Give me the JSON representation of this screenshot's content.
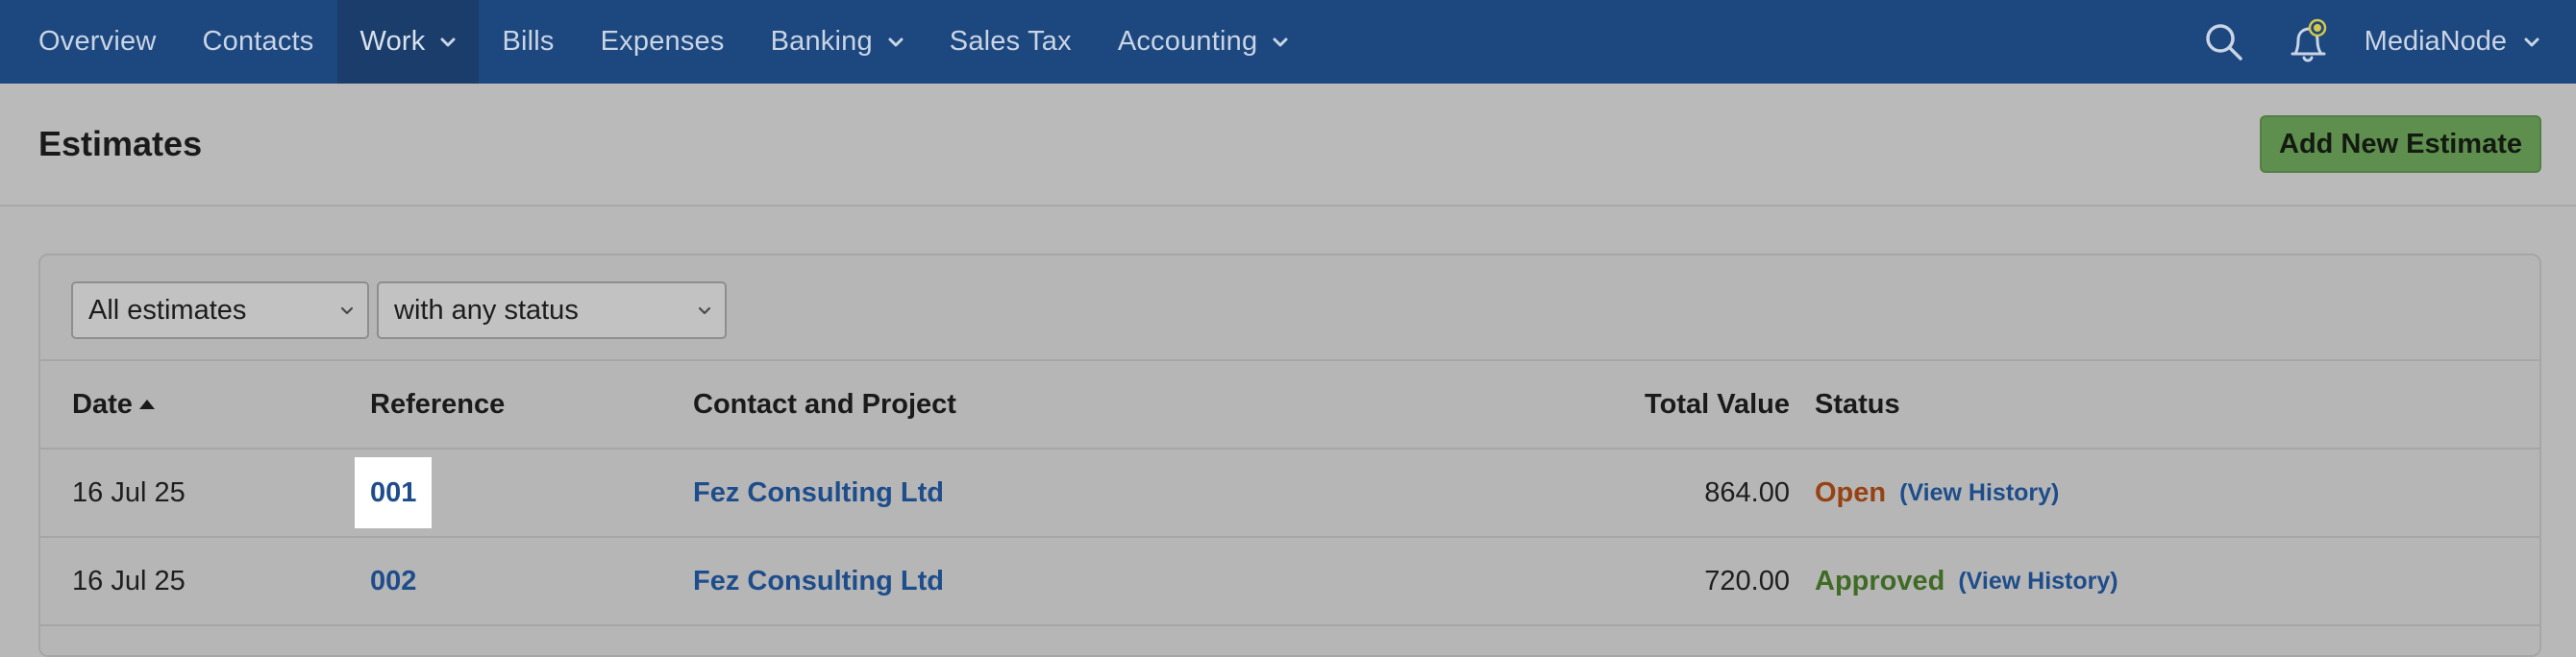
{
  "nav": {
    "items": [
      {
        "label": "Overview"
      },
      {
        "label": "Contacts"
      },
      {
        "label": "Work"
      },
      {
        "label": "Bills"
      },
      {
        "label": "Expenses"
      },
      {
        "label": "Banking"
      },
      {
        "label": "Sales Tax"
      },
      {
        "label": "Accounting"
      }
    ],
    "active": "Work",
    "account_name": "MediaNode"
  },
  "page": {
    "title": "Estimates",
    "add_button_label": "Add New Estimate"
  },
  "filters": {
    "scope_selected": "All estimates",
    "status_selected": "with any status"
  },
  "table": {
    "headers": {
      "date": "Date",
      "reference": "Reference",
      "contact": "Contact and Project",
      "total": "Total Value",
      "status": "Status"
    },
    "rows": [
      {
        "date": "16 Jul 25",
        "reference": "001",
        "contact": "Fez Consulting Ltd",
        "total": "864.00",
        "status": "Open",
        "history": "(View History)"
      },
      {
        "date": "16 Jul 25",
        "reference": "002",
        "contact": "Fez Consulting Ltd",
        "total": "720.00",
        "status": "Approved",
        "history": "(View History)"
      }
    ]
  },
  "colors": {
    "nav_bg": "#1c477f",
    "primary_button": "#5f8f4f",
    "link": "#1e4d8b",
    "status_open": "#974213",
    "status_approved": "#3f6b24"
  }
}
